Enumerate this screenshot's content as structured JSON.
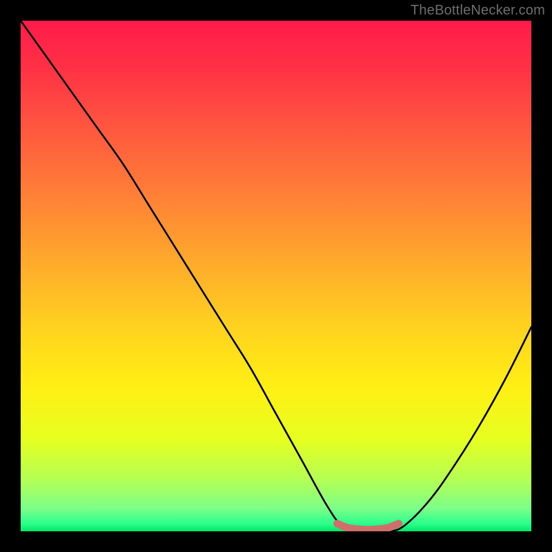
{
  "watermark": "TheBottleNecker.com",
  "chart_data": {
    "type": "line",
    "title": "",
    "xlabel": "",
    "ylabel": "",
    "xlim": [
      0,
      100
    ],
    "ylim": [
      0,
      100
    ],
    "series": [
      {
        "name": "bottleneck-curve",
        "color": "#000000",
        "x": [
          0,
          5,
          10,
          15,
          20,
          25,
          30,
          35,
          40,
          45,
          50,
          55,
          60,
          63,
          66,
          70,
          72,
          75,
          80,
          85,
          90,
          95,
          100
        ],
        "values": [
          100,
          93,
          86,
          79,
          72,
          64,
          56,
          48,
          40,
          32,
          23,
          14,
          5,
          1,
          0,
          0,
          0,
          1,
          6,
          13,
          21,
          30,
          40
        ]
      },
      {
        "name": "optimal-marker",
        "color": "#cf6f6b",
        "x": [
          62,
          64,
          66,
          68,
          70,
          72,
          74
        ],
        "values": [
          1.5,
          0.7,
          0.4,
          0.3,
          0.4,
          0.7,
          1.5
        ]
      }
    ],
    "gradient_stops": [
      {
        "offset": 0.0,
        "color": "#ff1b4a"
      },
      {
        "offset": 0.1,
        "color": "#ff3345"
      },
      {
        "offset": 0.22,
        "color": "#ff5a3f"
      },
      {
        "offset": 0.35,
        "color": "#ff8236"
      },
      {
        "offset": 0.48,
        "color": "#ffac2b"
      },
      {
        "offset": 0.6,
        "color": "#ffd21f"
      },
      {
        "offset": 0.72,
        "color": "#fff013"
      },
      {
        "offset": 0.82,
        "color": "#e6ff20"
      },
      {
        "offset": 0.9,
        "color": "#b3ff55"
      },
      {
        "offset": 0.955,
        "color": "#7dff88"
      },
      {
        "offset": 0.985,
        "color": "#2bff8c"
      },
      {
        "offset": 1.0,
        "color": "#00e765"
      }
    ]
  }
}
